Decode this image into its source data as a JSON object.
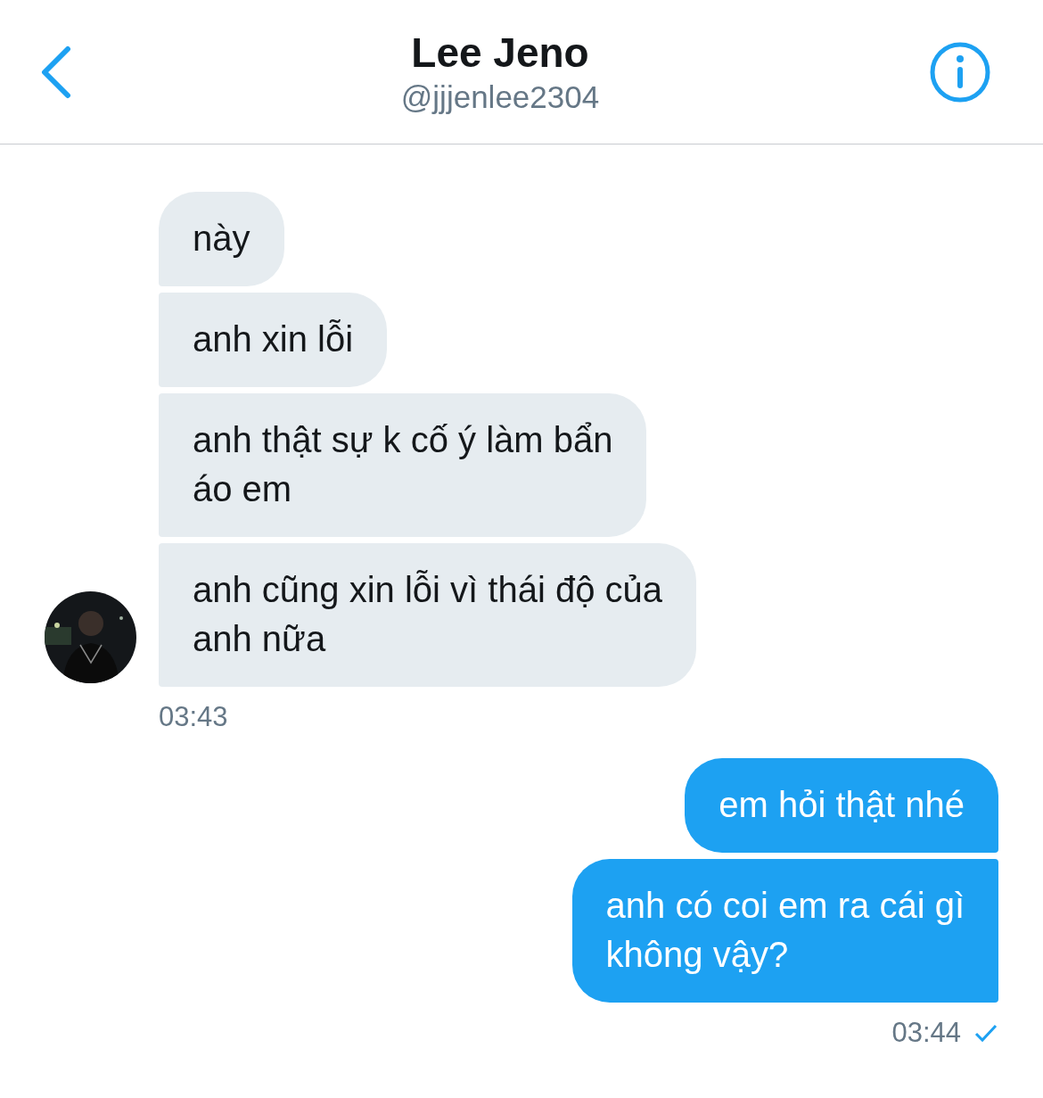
{
  "header": {
    "title": "Lee Jeno",
    "handle": "@jjjenlee2304"
  },
  "groups": [
    {
      "kind": "incoming",
      "messages": [
        {
          "lines": [
            "này"
          ]
        },
        {
          "lines": [
            "anh xin lỗi"
          ]
        },
        {
          "lines": [
            "anh thật sự k cố ý làm bẩn",
            "áo em"
          ]
        },
        {
          "lines": [
            "anh cũng xin lỗi vì thái độ của",
            "anh nữa"
          ]
        }
      ],
      "time": "03:43",
      "delivered": false
    },
    {
      "kind": "outgoing",
      "messages": [
        {
          "lines": [
            "em hỏi thật nhé"
          ]
        },
        {
          "lines": [
            "anh có coi em ra cái gì",
            "không vậy?"
          ]
        }
      ],
      "time": "03:44",
      "delivered": true
    }
  ]
}
